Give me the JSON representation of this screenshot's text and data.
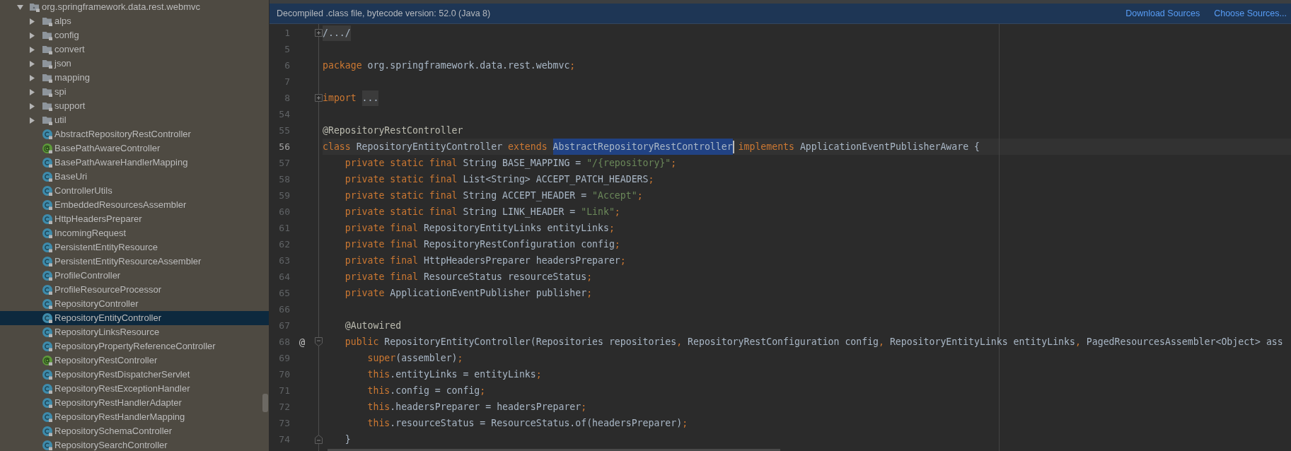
{
  "sidebar": {
    "tree": [
      {
        "label": "org.springframework.data.rest.webmvc",
        "kind": "package",
        "expanded": true,
        "selected": false,
        "children": [
          {
            "label": "alps",
            "kind": "folder",
            "expanded": false,
            "selected": false
          },
          {
            "label": "config",
            "kind": "folder",
            "expanded": false,
            "selected": false
          },
          {
            "label": "convert",
            "kind": "folder",
            "expanded": false,
            "selected": false
          },
          {
            "label": "json",
            "kind": "folder",
            "expanded": false,
            "selected": false
          },
          {
            "label": "mapping",
            "kind": "folder",
            "expanded": false,
            "selected": false
          },
          {
            "label": "spi",
            "kind": "folder",
            "expanded": false,
            "selected": false
          },
          {
            "label": "support",
            "kind": "folder",
            "expanded": false,
            "selected": false
          },
          {
            "label": "util",
            "kind": "folder",
            "expanded": false,
            "selected": false
          },
          {
            "label": "AbstractRepositoryRestController",
            "kind": "class",
            "selected": false
          },
          {
            "label": "BasePathAwareController",
            "kind": "annotation",
            "selected": false
          },
          {
            "label": "BasePathAwareHandlerMapping",
            "kind": "class",
            "selected": false
          },
          {
            "label": "BaseUri",
            "kind": "class",
            "selected": false
          },
          {
            "label": "ControllerUtils",
            "kind": "class",
            "selected": false
          },
          {
            "label": "EmbeddedResourcesAssembler",
            "kind": "class",
            "selected": false
          },
          {
            "label": "HttpHeadersPreparer",
            "kind": "class",
            "selected": false
          },
          {
            "label": "IncomingRequest",
            "kind": "class",
            "selected": false
          },
          {
            "label": "PersistentEntityResource",
            "kind": "class",
            "selected": false
          },
          {
            "label": "PersistentEntityResourceAssembler",
            "kind": "class",
            "selected": false
          },
          {
            "label": "ProfileController",
            "kind": "class",
            "selected": false
          },
          {
            "label": "ProfileResourceProcessor",
            "kind": "class",
            "selected": false
          },
          {
            "label": "RepositoryController",
            "kind": "class",
            "selected": false
          },
          {
            "label": "RepositoryEntityController",
            "kind": "class",
            "selected": true
          },
          {
            "label": "RepositoryLinksResource",
            "kind": "class",
            "selected": false
          },
          {
            "label": "RepositoryPropertyReferenceController",
            "kind": "class",
            "selected": false
          },
          {
            "label": "RepositoryRestController",
            "kind": "annotation",
            "selected": false
          },
          {
            "label": "RepositoryRestDispatcherServlet",
            "kind": "class",
            "selected": false
          },
          {
            "label": "RepositoryRestExceptionHandler",
            "kind": "class",
            "selected": false
          },
          {
            "label": "RepositoryRestHandlerAdapter",
            "kind": "class",
            "selected": false
          },
          {
            "label": "RepositoryRestHandlerMapping",
            "kind": "class",
            "selected": false
          },
          {
            "label": "RepositorySchemaController",
            "kind": "class",
            "selected": false
          },
          {
            "label": "RepositorySearchController",
            "kind": "class",
            "selected": false
          }
        ]
      }
    ]
  },
  "editor": {
    "banner": {
      "text": "Decompiled .class file, bytecode version: 52.0 (Java 8)",
      "links": [
        "Download Sources",
        "Choose Sources..."
      ]
    },
    "lines": [
      {
        "number": "1",
        "current": false,
        "fold": {
          "kind": "collapsed"
        },
        "tokens": [
          {
            "text": "/.../",
            "kind": "folded"
          }
        ]
      },
      {
        "number": "5",
        "current": false
      },
      {
        "number": "6",
        "current": false,
        "tokens": [
          {
            "text": "package ",
            "kind": "keyword"
          },
          {
            "text": "org.springframework.data.rest.webmvc",
            "kind": "plain"
          },
          {
            "text": ";",
            "kind": "punct"
          }
        ]
      },
      {
        "number": "7",
        "current": false
      },
      {
        "number": "8",
        "current": false,
        "fold": {
          "kind": "collapsed"
        },
        "tokens": [
          {
            "text": "import ",
            "kind": "keyword"
          },
          {
            "text": "...",
            "kind": "folded"
          }
        ]
      },
      {
        "number": "54",
        "current": false
      },
      {
        "number": "55",
        "current": false,
        "tokens": [
          {
            "text": "@RepositoryRestController",
            "kind": "annotation"
          }
        ]
      },
      {
        "number": "56",
        "current": true,
        "tokens": [
          {
            "text": "class ",
            "kind": "keyword"
          },
          {
            "text": "RepositoryEntityController ",
            "kind": "plain"
          },
          {
            "text": "extends ",
            "kind": "keyword"
          },
          {
            "text": "AbstractRepositoryRestController",
            "kind": "selection"
          },
          {
            "text": " implements ",
            "kind": "keyword"
          },
          {
            "text": "ApplicationEventPublisherAware {",
            "kind": "plain"
          }
        ],
        "children": [
          {
            "number": "57",
            "current": false,
            "tokens": [
              {
                "text": "private static final ",
                "kind": "keyword"
              },
              {
                "text": "String BASE_MAPPING = ",
                "kind": "plain"
              },
              {
                "text": "\"/{repository}\"",
                "kind": "string"
              },
              {
                "text": ";",
                "kind": "punct"
              }
            ]
          },
          {
            "number": "58",
            "current": false,
            "tokens": [
              {
                "text": "private static final ",
                "kind": "keyword"
              },
              {
                "text": "List<String> ACCEPT_PATCH_HEADERS",
                "kind": "plain"
              },
              {
                "text": ";",
                "kind": "punct"
              }
            ]
          },
          {
            "number": "59",
            "current": false,
            "tokens": [
              {
                "text": "private static final ",
                "kind": "keyword"
              },
              {
                "text": "String ACCEPT_HEADER = ",
                "kind": "plain"
              },
              {
                "text": "\"Accept\"",
                "kind": "string"
              },
              {
                "text": ";",
                "kind": "punct"
              }
            ]
          },
          {
            "number": "60",
            "current": false,
            "tokens": [
              {
                "text": "private static final ",
                "kind": "keyword"
              },
              {
                "text": "String LINK_HEADER = ",
                "kind": "plain"
              },
              {
                "text": "\"Link\"",
                "kind": "string"
              },
              {
                "text": ";",
                "kind": "punct"
              }
            ]
          },
          {
            "number": "61",
            "current": false,
            "tokens": [
              {
                "text": "private final ",
                "kind": "keyword"
              },
              {
                "text": "RepositoryEntityLinks entityLinks",
                "kind": "plain"
              },
              {
                "text": ";",
                "kind": "punct"
              }
            ]
          },
          {
            "number": "62",
            "current": false,
            "tokens": [
              {
                "text": "private final ",
                "kind": "keyword"
              },
              {
                "text": "RepositoryRestConfiguration config",
                "kind": "plain"
              },
              {
                "text": ";",
                "kind": "punct"
              }
            ]
          },
          {
            "number": "63",
            "current": false,
            "tokens": [
              {
                "text": "private final ",
                "kind": "keyword"
              },
              {
                "text": "HttpHeadersPreparer headersPreparer",
                "kind": "plain"
              },
              {
                "text": ";",
                "kind": "punct"
              }
            ]
          },
          {
            "number": "64",
            "current": false,
            "tokens": [
              {
                "text": "private final ",
                "kind": "keyword"
              },
              {
                "text": "ResourceStatus resourceStatus",
                "kind": "plain"
              },
              {
                "text": ";",
                "kind": "punct"
              }
            ]
          },
          {
            "number": "65",
            "current": false,
            "tokens": [
              {
                "text": "private ",
                "kind": "keyword"
              },
              {
                "text": "ApplicationEventPublisher publisher",
                "kind": "plain"
              },
              {
                "text": ";",
                "kind": "punct"
              }
            ]
          },
          {
            "number": "66",
            "current": false
          },
          {
            "number": "67",
            "current": false,
            "tokens": [
              {
                "text": "@Autowired",
                "kind": "annotation"
              }
            ]
          },
          {
            "number": "68",
            "current": false,
            "gutter_mark": "@",
            "fold": {
              "kind": "start"
            },
            "tokens": [
              {
                "text": "public ",
                "kind": "keyword"
              },
              {
                "text": "RepositoryEntityController(Repositories repositories",
                "kind": "plain"
              },
              {
                "text": ",",
                "kind": "punct"
              },
              {
                "text": " RepositoryRestConfiguration config",
                "kind": "plain"
              },
              {
                "text": ",",
                "kind": "punct"
              },
              {
                "text": " RepositoryEntityLinks entityLinks",
                "kind": "plain"
              },
              {
                "text": ",",
                "kind": "punct"
              },
              {
                "text": " PagedResourcesAssembler<Object> ass",
                "kind": "plain"
              }
            ],
            "children": [
              {
                "number": "69",
                "current": false,
                "tokens": [
                  {
                    "text": "super",
                    "kind": "keyword"
                  },
                  {
                    "text": "(assembler)",
                    "kind": "plain"
                  },
                  {
                    "text": ";",
                    "kind": "punct"
                  }
                ]
              },
              {
                "number": "70",
                "current": false,
                "tokens": [
                  {
                    "text": "this",
                    "kind": "keyword"
                  },
                  {
                    "text": ".entityLinks = entityLinks",
                    "kind": "plain"
                  },
                  {
                    "text": ";",
                    "kind": "punct"
                  }
                ]
              },
              {
                "number": "71",
                "current": false,
                "tokens": [
                  {
                    "text": "this",
                    "kind": "keyword"
                  },
                  {
                    "text": ".config = config",
                    "kind": "plain"
                  },
                  {
                    "text": ";",
                    "kind": "punct"
                  }
                ]
              },
              {
                "number": "72",
                "current": false,
                "tokens": [
                  {
                    "text": "this",
                    "kind": "keyword"
                  },
                  {
                    "text": ".headersPreparer = headersPreparer",
                    "kind": "plain"
                  },
                  {
                    "text": ";",
                    "kind": "punct"
                  }
                ]
              },
              {
                "number": "73",
                "current": false,
                "tokens": [
                  {
                    "text": "this",
                    "kind": "keyword"
                  },
                  {
                    "text": ".resourceStatus = ResourceStatus.of(headersPreparer)",
                    "kind": "plain"
                  },
                  {
                    "text": ";",
                    "kind": "punct"
                  }
                ]
              }
            ]
          },
          {
            "number": "74",
            "current": false,
            "fold": {
              "kind": "end"
            },
            "tokens": [
              {
                "text": "}",
                "kind": "plain"
              }
            ]
          }
        ]
      }
    ]
  }
}
